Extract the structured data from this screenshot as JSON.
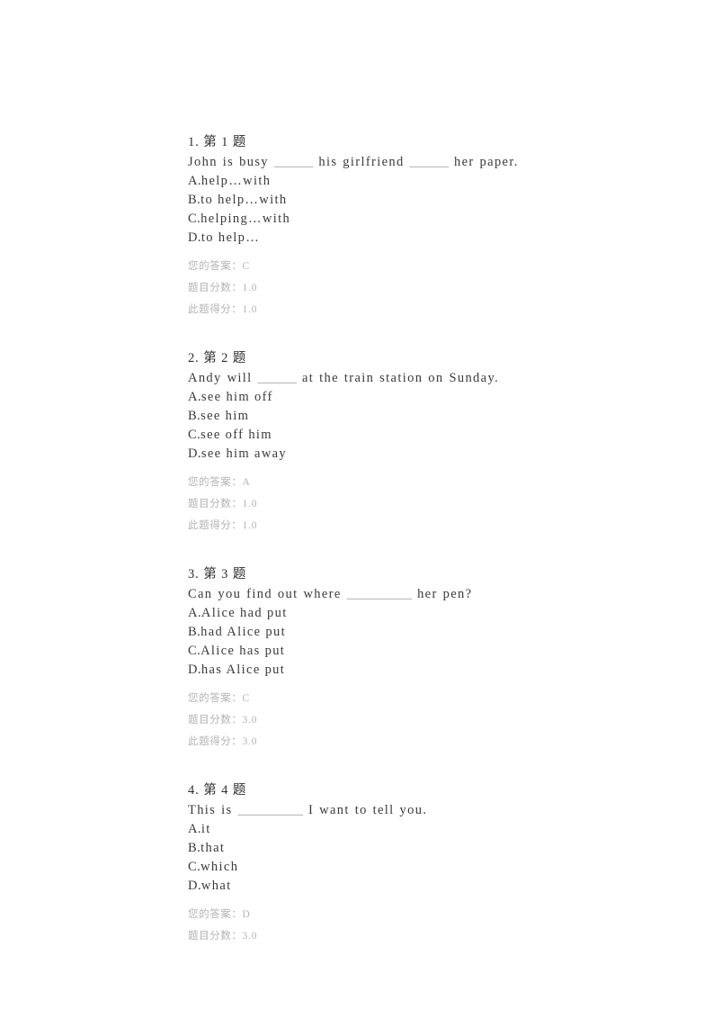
{
  "page": {
    "background": "#ffffff",
    "text_color": "#3a3a3a",
    "meta_color": "#b3b3b3",
    "blank_color": "#9a9a9a"
  },
  "labels": {
    "your_answer": "您的答案：",
    "question_score": "题目分数：",
    "earned_score": "此题得分："
  },
  "questions": [
    {
      "heading": "1. 第 1 题",
      "stem_parts": [
        {
          "type": "text",
          "value": "John is busy "
        },
        {
          "type": "blank",
          "value": "______"
        },
        {
          "type": "text",
          "value": " his girlfriend "
        },
        {
          "type": "blank",
          "value": "______"
        },
        {
          "type": "text",
          "value": " her paper."
        }
      ],
      "options": [
        {
          "letter": "A.",
          "text": "help…with"
        },
        {
          "letter": "B.",
          "text": "to help…with"
        },
        {
          "letter": "C.",
          "text": "helping…with"
        },
        {
          "letter": "D.",
          "text": "to help…"
        }
      ],
      "your_answer": "C",
      "question_score": "1.0",
      "earned_score": "1.0"
    },
    {
      "heading": "2. 第 2 题",
      "stem_parts": [
        {
          "type": "text",
          "value": "Andy will "
        },
        {
          "type": "blank",
          "value": "______"
        },
        {
          "type": "text",
          "value": " at the train station on Sunday."
        }
      ],
      "options": [
        {
          "letter": "A.",
          "text": "see him off"
        },
        {
          "letter": "B.",
          "text": "see him"
        },
        {
          "letter": "C.",
          "text": "see off him"
        },
        {
          "letter": "D.",
          "text": "see him away"
        }
      ],
      "your_answer": "A",
      "question_score": "1.0",
      "earned_score": "1.0"
    },
    {
      "heading": "3. 第 3 题",
      "stem_parts": [
        {
          "type": "text",
          "value": "Can you find out where "
        },
        {
          "type": "blank",
          "value": "__________"
        },
        {
          "type": "text",
          "value": " her pen?"
        }
      ],
      "options": [
        {
          "letter": "A.",
          "text": "Alice had put"
        },
        {
          "letter": "B.",
          "text": "had Alice put"
        },
        {
          "letter": "C.",
          "text": "Alice has put"
        },
        {
          "letter": "D.",
          "text": "has Alice put"
        }
      ],
      "your_answer": "C",
      "question_score": "3.0",
      "earned_score": "3.0"
    },
    {
      "heading": "4. 第 4 题",
      "stem_parts": [
        {
          "type": "text",
          "value": "This is "
        },
        {
          "type": "blank",
          "value": "__________"
        },
        {
          "type": "text",
          "value": " I want to tell you."
        }
      ],
      "options": [
        {
          "letter": "A.",
          "text": "it"
        },
        {
          "letter": "B.",
          "text": "that"
        },
        {
          "letter": "C.",
          "text": "which"
        },
        {
          "letter": "D.",
          "text": "what"
        }
      ],
      "your_answer": "D",
      "question_score": "3.0",
      "earned_score": null
    }
  ]
}
